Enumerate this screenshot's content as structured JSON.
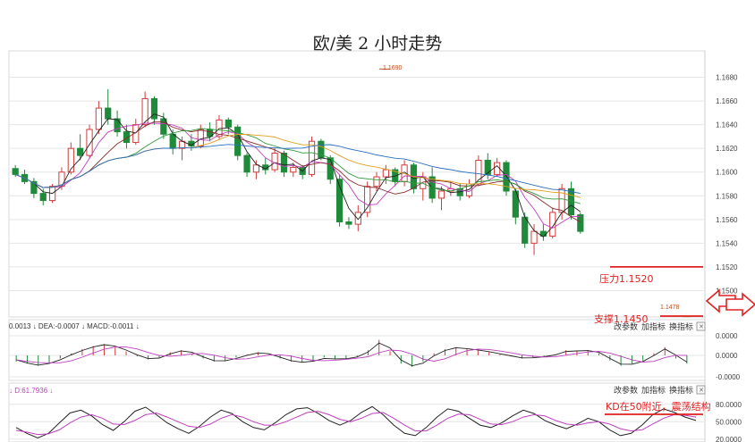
{
  "title": "欧/美 2 小时走势",
  "colors": {
    "up": "#d23b3b",
    "down": "#1f8a3a",
    "accent": "#e02020",
    "grid": "#e6e6e6"
  },
  "chart_data": [
    {
      "type": "candlestick",
      "name": "price",
      "ylim": [
        1.148,
        1.17
      ],
      "y_ticks": [
        "1.1680",
        "1.1660",
        "1.1640",
        "1.1620",
        "1.1600",
        "1.1580",
        "1.1560",
        "1.1540",
        "1.1520",
        "1.1500"
      ],
      "candles": [
        {
          "o": 1.1603,
          "h": 1.1606,
          "l": 1.1596,
          "c": 1.1598
        },
        {
          "o": 1.1598,
          "h": 1.1602,
          "l": 1.159,
          "c": 1.1592
        },
        {
          "o": 1.1592,
          "h": 1.1595,
          "l": 1.1578,
          "c": 1.1582
        },
        {
          "o": 1.1582,
          "h": 1.1586,
          "l": 1.1572,
          "c": 1.1576
        },
        {
          "o": 1.1576,
          "h": 1.159,
          "l": 1.1574,
          "c": 1.1588
        },
        {
          "o": 1.1588,
          "h": 1.1604,
          "l": 1.1585,
          "c": 1.16
        },
        {
          "o": 1.16,
          "h": 1.1625,
          "l": 1.1598,
          "c": 1.162
        },
        {
          "o": 1.162,
          "h": 1.1632,
          "l": 1.161,
          "c": 1.1614
        },
        {
          "o": 1.1614,
          "h": 1.164,
          "l": 1.1612,
          "c": 1.1636
        },
        {
          "o": 1.1636,
          "h": 1.166,
          "l": 1.1632,
          "c": 1.1654
        },
        {
          "o": 1.1654,
          "h": 1.167,
          "l": 1.164,
          "c": 1.1645
        },
        {
          "o": 1.1645,
          "h": 1.1652,
          "l": 1.163,
          "c": 1.1634
        },
        {
          "o": 1.1634,
          "h": 1.164,
          "l": 1.162,
          "c": 1.1625
        },
        {
          "o": 1.1625,
          "h": 1.1645,
          "l": 1.1623,
          "c": 1.164
        },
        {
          "o": 1.164,
          "h": 1.1668,
          "l": 1.1638,
          "c": 1.1662
        },
        {
          "o": 1.1662,
          "h": 1.1664,
          "l": 1.164,
          "c": 1.1645
        },
        {
          "o": 1.1645,
          "h": 1.165,
          "l": 1.1628,
          "c": 1.1632
        },
        {
          "o": 1.1632,
          "h": 1.1636,
          "l": 1.1615,
          "c": 1.162
        },
        {
          "o": 1.162,
          "h": 1.163,
          "l": 1.161,
          "c": 1.1626
        },
        {
          "o": 1.1626,
          "h": 1.1632,
          "l": 1.1618,
          "c": 1.1622
        },
        {
          "o": 1.1622,
          "h": 1.164,
          "l": 1.162,
          "c": 1.1636
        },
        {
          "o": 1.1636,
          "h": 1.1642,
          "l": 1.1626,
          "c": 1.163
        },
        {
          "o": 1.163,
          "h": 1.1648,
          "l": 1.1628,
          "c": 1.1644
        },
        {
          "o": 1.1644,
          "h": 1.1646,
          "l": 1.1632,
          "c": 1.1638
        },
        {
          "o": 1.1638,
          "h": 1.164,
          "l": 1.161,
          "c": 1.1614
        },
        {
          "o": 1.1614,
          "h": 1.1616,
          "l": 1.1596,
          "c": 1.16
        },
        {
          "o": 1.16,
          "h": 1.161,
          "l": 1.1594,
          "c": 1.1606
        },
        {
          "o": 1.1606,
          "h": 1.1612,
          "l": 1.1598,
          "c": 1.1602
        },
        {
          "o": 1.1602,
          "h": 1.162,
          "l": 1.16,
          "c": 1.1616
        },
        {
          "o": 1.1616,
          "h": 1.1618,
          "l": 1.1596,
          "c": 1.16
        },
        {
          "o": 1.16,
          "h": 1.1608,
          "l": 1.1596,
          "c": 1.1604
        },
        {
          "o": 1.1604,
          "h": 1.1606,
          "l": 1.1594,
          "c": 1.1598
        },
        {
          "o": 1.1598,
          "h": 1.163,
          "l": 1.1596,
          "c": 1.1626
        },
        {
          "o": 1.1626,
          "h": 1.1628,
          "l": 1.161,
          "c": 1.1612
        },
        {
          "o": 1.1612,
          "h": 1.1614,
          "l": 1.159,
          "c": 1.1594
        },
        {
          "o": 1.1594,
          "h": 1.1598,
          "l": 1.1554,
          "c": 1.1558
        },
        {
          "o": 1.1558,
          "h": 1.1562,
          "l": 1.1552,
          "c": 1.1556
        },
        {
          "o": 1.1556,
          "h": 1.1572,
          "l": 1.155,
          "c": 1.1566
        },
        {
          "o": 1.1566,
          "h": 1.1592,
          "l": 1.1562,
          "c": 1.1588
        },
        {
          "o": 1.1588,
          "h": 1.16,
          "l": 1.1584,
          "c": 1.1596
        },
        {
          "o": 1.1596,
          "h": 1.1606,
          "l": 1.159,
          "c": 1.1602
        },
        {
          "o": 1.1602,
          "h": 1.1604,
          "l": 1.1588,
          "c": 1.1592
        },
        {
          "o": 1.1592,
          "h": 1.161,
          "l": 1.1588,
          "c": 1.1606
        },
        {
          "o": 1.1606,
          "h": 1.1608,
          "l": 1.1582,
          "c": 1.1586
        },
        {
          "o": 1.1586,
          "h": 1.16,
          "l": 1.1576,
          "c": 1.1596
        },
        {
          "o": 1.1596,
          "h": 1.1604,
          "l": 1.1574,
          "c": 1.1578
        },
        {
          "o": 1.1578,
          "h": 1.1588,
          "l": 1.1568,
          "c": 1.1584
        },
        {
          "o": 1.1584,
          "h": 1.1592,
          "l": 1.158,
          "c": 1.1586
        },
        {
          "o": 1.1586,
          "h": 1.159,
          "l": 1.1576,
          "c": 1.158
        },
        {
          "o": 1.158,
          "h": 1.1594,
          "l": 1.1578,
          "c": 1.159
        },
        {
          "o": 1.159,
          "h": 1.1614,
          "l": 1.1588,
          "c": 1.161
        },
        {
          "o": 1.161,
          "h": 1.1616,
          "l": 1.1594,
          "c": 1.1598
        },
        {
          "o": 1.1598,
          "h": 1.1612,
          "l": 1.1596,
          "c": 1.1608
        },
        {
          "o": 1.1608,
          "h": 1.161,
          "l": 1.158,
          "c": 1.1584
        },
        {
          "o": 1.1584,
          "h": 1.1586,
          "l": 1.1556,
          "c": 1.1562
        },
        {
          "o": 1.1562,
          "h": 1.1566,
          "l": 1.1536,
          "c": 1.154
        },
        {
          "o": 1.154,
          "h": 1.1556,
          "l": 1.153,
          "c": 1.155
        },
        {
          "o": 1.155,
          "h": 1.1556,
          "l": 1.1542,
          "c": 1.1546
        },
        {
          "o": 1.1546,
          "h": 1.157,
          "l": 1.1544,
          "c": 1.1566
        },
        {
          "o": 1.1566,
          "h": 1.159,
          "l": 1.156,
          "c": 1.1586
        },
        {
          "o": 1.1586,
          "h": 1.1592,
          "l": 1.156,
          "c": 1.1564
        },
        {
          "o": 1.1564,
          "h": 1.1566,
          "l": 1.1548,
          "c": 1.155
        }
      ],
      "markers": [
        {
          "label": "1.1690",
          "value": 1.169
        },
        {
          "label": "1.1478",
          "value": 1.1478
        }
      ],
      "levels": [
        {
          "label": "压力1.1520",
          "value": 1.152
        },
        {
          "label": "支撑1.1450",
          "value": 1.145
        }
      ]
    },
    {
      "type": "bar",
      "name": "MACD",
      "header": "0.0013 ↓ DEA:-0.0007 ↓ MACD:-0.0011 ↓",
      "ylim": [
        -0.0045,
        0.0045
      ],
      "y_ticks": [
        "0.0000",
        "0.0000",
        "-0.0000"
      ],
      "values": [
        -0.0012,
        -0.0016,
        -0.002,
        -0.0014,
        -0.0006,
        0.0004,
        0.0012,
        0.0018,
        0.0022,
        0.0016,
        0.0008,
        -0.0002,
        -0.0008,
        -0.0004,
        0.0006,
        0.001,
        0.0004,
        -0.0006,
        -0.0012,
        -0.001,
        -0.0004,
        0.0002,
        0.0006,
        0.0002,
        -0.0006,
        -0.0012,
        -0.0014,
        -0.001,
        -0.0004,
        -0.0008,
        -0.0006,
        -0.0002,
        0.001,
        0.003,
        0.0008,
        -0.0016,
        -0.0022,
        -0.0012,
        0.0004,
        0.0012,
        0.0016,
        0.0012,
        0.001,
        0.0006,
        0.0002,
        -0.0002,
        -0.0006,
        -0.0004,
        -0.0002,
        0.0002,
        0.001,
        0.0008,
        0.001,
        0.0004,
        -0.001,
        -0.002,
        -0.0016,
        -0.001,
        0.0004,
        0.0016,
        -0.0006,
        -0.0016
      ]
    },
    {
      "type": "line",
      "name": "KD",
      "header": "↓ D:61.7936 ↓",
      "ylim": [
        15,
        95
      ],
      "y_ticks": [
        "80.0000",
        "50.0000",
        "20.0000"
      ],
      "annotation": "KD在50附近，震荡结构",
      "series": [
        {
          "values": [
            40,
            30,
            22,
            30,
            48,
            65,
            70,
            60,
            45,
            35,
            50,
            68,
            75,
            62,
            48,
            38,
            30,
            42,
            58,
            70,
            64,
            50,
            40,
            36,
            48,
            62,
            72,
            74,
            64,
            52,
            44,
            52,
            66,
            76,
            62,
            44,
            30,
            26,
            40,
            58,
            72,
            68,
            56,
            44,
            40,
            48,
            60,
            70,
            64,
            52,
            44,
            38,
            46,
            56,
            50,
            36,
            26,
            30,
            44,
            62,
            72,
            66,
            58,
            52
          ]
        },
        {
          "values": [
            35,
            32,
            28,
            29,
            36,
            48,
            58,
            62,
            56,
            46,
            45,
            52,
            62,
            65,
            58,
            50,
            42,
            40,
            46,
            56,
            62,
            58,
            50,
            44,
            44,
            50,
            58,
            66,
            68,
            62,
            54,
            50,
            56,
            64,
            66,
            56,
            44,
            34,
            34,
            44,
            56,
            63,
            62,
            54,
            46,
            45,
            50,
            58,
            62,
            60,
            52,
            46,
            44,
            48,
            50,
            46,
            38,
            34,
            36,
            46,
            56,
            62,
            61,
            58
          ]
        }
      ]
    }
  ],
  "panel_buttons": [
    "改参数",
    "加指标",
    "换指标"
  ],
  "close_icon": "✕"
}
